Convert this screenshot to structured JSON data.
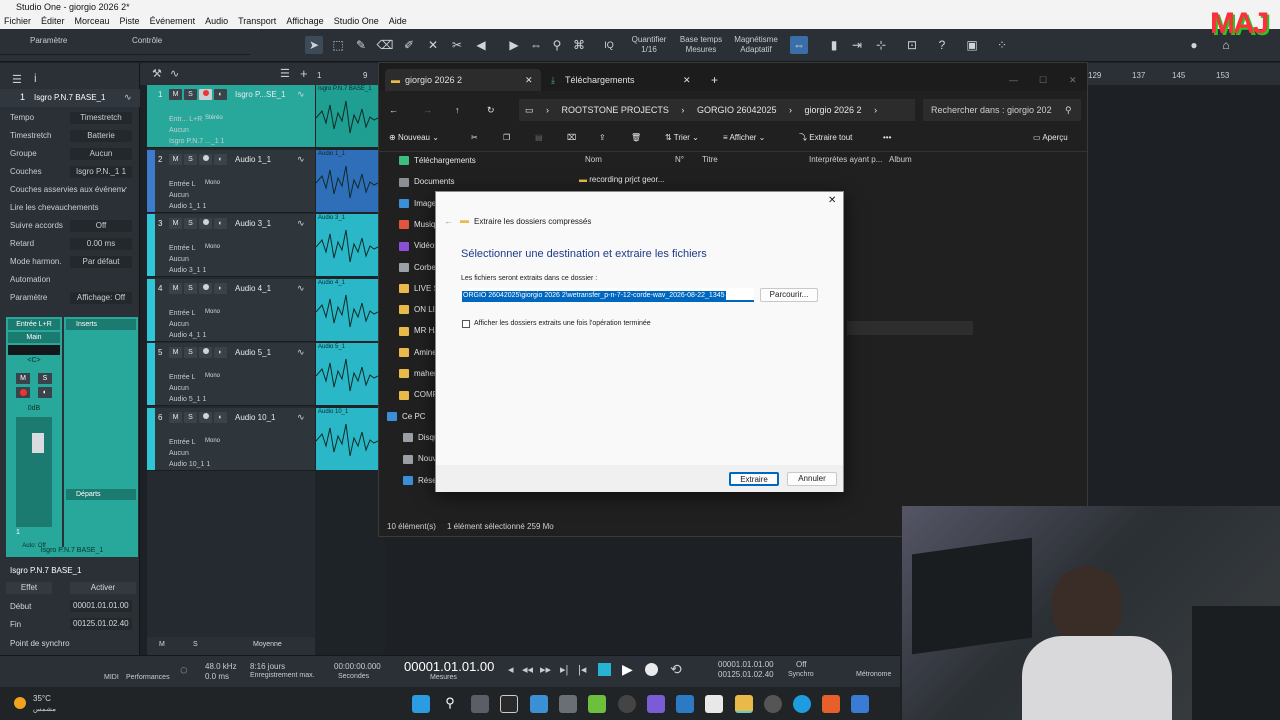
{
  "window": {
    "title": "Studio One - giorgio 2026 2*"
  },
  "menu": [
    "Fichier",
    "Éditer",
    "Morceau",
    "Piste",
    "Événement",
    "Audio",
    "Transport",
    "Affichage",
    "Studio One",
    "Aide"
  ],
  "toolbar": {
    "left_tabs": [
      "Paramètre",
      "Contrôle"
    ],
    "quantize": {
      "label": "Quantifier",
      "value": "1/16"
    },
    "timebase": {
      "label": "Base temps",
      "value": "Mesures"
    },
    "snap": {
      "label": "Magnétisme",
      "value": "Adaptatif"
    },
    "iq": "IQ"
  },
  "inspector": {
    "track_num": "1",
    "track_name": "Isgro P.N.7 BASE_1",
    "rows": [
      {
        "k": "Tempo",
        "v": "Timestretch"
      },
      {
        "k": "Timestretch",
        "v": "Batterie"
      },
      {
        "k": "Groupe",
        "v": "Aucun"
      },
      {
        "k": "Couches",
        "v": "Isgro P.N._1 1"
      },
      {
        "k": "Couches asservies aux événem.",
        "v": "✓"
      },
      {
        "k": "Lire les chevauchements",
        "v": ""
      },
      {
        "k": "Suivre accords",
        "v": "Off"
      },
      {
        "k": "Retard",
        "v": "0.00 ms"
      },
      {
        "k": "Mode harmon.",
        "v": "Par défaut"
      },
      {
        "k": "Automation",
        "v": ""
      },
      {
        "k": "Paramètre",
        "v": "Affichage: Off"
      }
    ],
    "channel": {
      "input": "Entrée L+R",
      "output": "Main",
      "pan": "<C>",
      "level": "0dB",
      "m": "M",
      "s": "S",
      "inserts": "Inserts",
      "sends": "Départs",
      "auto": "Auto: Off",
      "num": "1",
      "name": "Isgro P.N.7 BASE_1"
    },
    "event": {
      "name": "Isgro P.N.7 BASE_1",
      "effect": "Effet",
      "activate": "Activer",
      "start_label": "Début",
      "start": "00001.01.01.00",
      "end_label": "Fin",
      "end": "00125.01.02.40",
      "sync_label": "Point de synchro"
    }
  },
  "tracks": [
    {
      "num": "1",
      "name": "Isgro P...SE_1",
      "in": "Entr... L+R",
      "stereo": "Stéréo",
      "aux": "Aucun",
      "lane": "Isgro P.N.7 ..._1 1",
      "selected": true,
      "color": "#27a89b"
    },
    {
      "num": "2",
      "name": "Audio 1_1",
      "in": "Entrée L",
      "mono": "Mono",
      "aux": "Aucun",
      "lane": "Audio 1_1 1",
      "selected": false,
      "color": "#3d7ccd"
    },
    {
      "num": "3",
      "name": "Audio 3_1",
      "in": "Entrée L",
      "mono": "Mono",
      "aux": "Aucun",
      "lane": "Audio 3_1 1",
      "selected": false,
      "color": "#2fc7d8"
    },
    {
      "num": "4",
      "name": "Audio 4_1",
      "in": "Entrée L",
      "mono": "Mono",
      "aux": "Aucun",
      "lane": "Audio 4_1 1",
      "selected": false,
      "color": "#2fc7d8"
    },
    {
      "num": "5",
      "name": "Audio 5_1",
      "in": "Entrée L",
      "mono": "Mono",
      "aux": "Aucun",
      "lane": "Audio 5_1 1",
      "selected": false,
      "color": "#2fc7d8"
    },
    {
      "num": "6",
      "name": "Audio 10_1",
      "in": "Entrée L",
      "mono": "Mono",
      "aux": "Aucun",
      "lane": "Audio 10_1 1",
      "selected": false,
      "color": "#2fc7d8"
    }
  ],
  "clips": [
    "Isgro P.N.7 BASE_1",
    "Audio 1_1",
    "Audio 3_1",
    "Audio 4_1",
    "Audio 5_1",
    "Audio 10_1"
  ],
  "ruler": {
    "marks": [
      "1",
      "9",
      "129",
      "137",
      "145",
      "153"
    ]
  },
  "tracklist_footer": {
    "m": "M",
    "s": "S",
    "size": "Moyenne"
  },
  "explorer": {
    "tabs": [
      "giorgio 2026 2",
      "Téléchargements"
    ],
    "breadcrumb": [
      "ROOTSTONE PROJECTS",
      "GORGIO 26042025",
      "giorgio 2026 2"
    ],
    "search_placeholder": "Rechercher dans : giorgio 202",
    "commands": {
      "new": "Nouveau",
      "sort": "Trier",
      "view": "Afficher",
      "extract_all": "Extraire tout",
      "preview": "Aperçu"
    },
    "nav": [
      "Téléchargements",
      "Documents",
      "Images",
      "Musique",
      "Vidéos",
      "Corbeille",
      "LIVE STR",
      "ON LIN",
      "MR HA",
      "Amine",
      "maher",
      "COMP",
      "Ce PC",
      "Disque",
      "Nouveau",
      "Réseau"
    ],
    "columns": [
      "Nom",
      "N°",
      "Titre",
      "Interprètes ayant p...",
      "Album"
    ],
    "files": [
      "recording prjct geor..."
    ],
    "status": {
      "count": "10 élément(s)",
      "selection": "1 élément sélectionné  259 Mo"
    }
  },
  "dialog": {
    "title": "Extraire les dossiers compressés",
    "heading": "Sélectionner une destination et extraire les fichiers",
    "field_label": "Les fichiers seront extraits dans ce dossier :",
    "path": "ORGIO 26042025\\giorgio 2026 2\\wetransfer_p-n-7-12-corde-wav_2026-08-22_1345",
    "browse": "Parcourir...",
    "checkbox": "Afficher les dossiers extraits une fois l'opération terminée",
    "extract": "Extraire",
    "cancel": "Annuler"
  },
  "transport": {
    "midi": "MIDI",
    "performance": "Performances",
    "rate": "48.0 kHz",
    "latency": "0.0 ms",
    "record_days": "8:16 jours",
    "record_label": "Enregistrement max.",
    "seconds": "00:00:00.000",
    "seconds_label": "Secondes",
    "bars": "00001.01.01.00",
    "bars_label": "Mesures",
    "loop_start": "00001.01.01.00",
    "loop_end": "00125.01.02.40",
    "sync": "Off",
    "sync_label": "Synchro",
    "metronome_label": "Métronome"
  },
  "taskbar": {
    "temp": "35°C",
    "weather": "مشمس"
  },
  "logo": "MAJ"
}
